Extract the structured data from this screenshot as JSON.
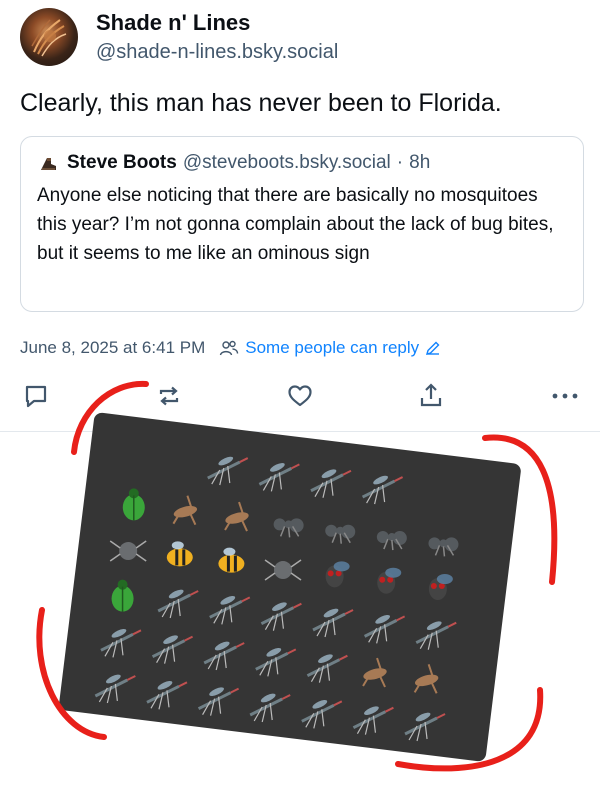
{
  "post": {
    "author": {
      "display_name": "Shade n' Lines",
      "handle": "@shade-n-lines.bsky.social"
    },
    "text": "Clearly, this man has never been to Florida.",
    "quote": {
      "display_name": "Steve Boots",
      "handle": "@steveboots.bsky.social",
      "time": "8h",
      "separator": "·",
      "text": "Anyone else noticing that there are basically no mosquitoes this year? I’m not gonna complain about the lack of bug bites, but it seems to me like an ominous sign"
    },
    "timestamp": "June 8, 2025 at 6:41 PM",
    "reply_setting": "Some people can reply"
  },
  "actions": [
    {
      "icon": "reply-icon"
    },
    {
      "icon": "repost-icon"
    },
    {
      "icon": "like-icon"
    },
    {
      "icon": "share-icon"
    },
    {
      "icon": "more-icon"
    }
  ],
  "image": {
    "description_icons": [
      "mosquito",
      "beetle",
      "cricket",
      "ant",
      "spider",
      "bee",
      "fly"
    ],
    "annotation_color": "#e8201a",
    "card_color": "#353535"
  },
  "colors": {
    "accent": "#1083fe",
    "muted": "#42576c",
    "border": "#d4dbe2"
  }
}
